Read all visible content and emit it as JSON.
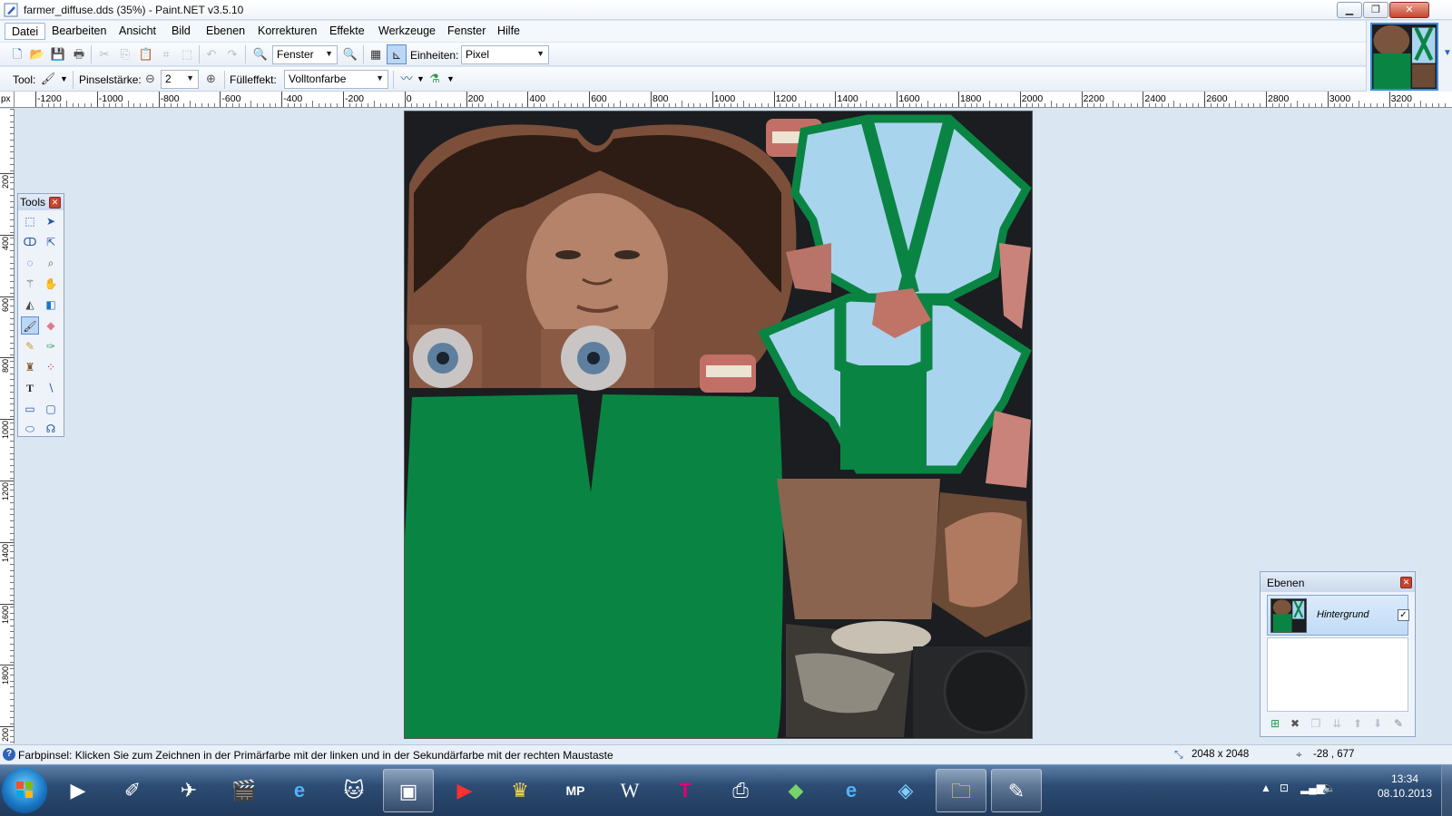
{
  "window": {
    "title": "farmer_diffuse.dds (35%) - Paint.NET v3.5.10"
  },
  "window_buttons": {
    "minimize": "▁",
    "maximize": "❐",
    "close": "✕"
  },
  "menu": [
    "Datei",
    "Bearbeiten",
    "Ansicht",
    "Bild",
    "Ebenen",
    "Korrekturen",
    "Effekte",
    "Werkzeuge",
    "Fenster",
    "Hilfe"
  ],
  "toolbar1": {
    "zoom_value": "Fenster",
    "units_label": "Einheiten:",
    "units_value": "Pixel",
    "icons": [
      "new-file-icon",
      "open-file-icon",
      "save-icon",
      "print-icon",
      "cut-icon",
      "copy-icon",
      "paste-icon",
      "crop-icon",
      "deselect-icon",
      "undo-icon",
      "redo-icon",
      "zoom-out-icon",
      "zoom-in-icon",
      "grid-icon",
      "rulers-icon"
    ]
  },
  "toolbar2": {
    "tool_label": "Tool:",
    "brush_width_label": "Pinselstärke:",
    "brush_width_value": "2",
    "fill_label": "Fülleffekt:",
    "fill_value": "Volltonfarbe"
  },
  "ruler": {
    "unit": "px",
    "h_labels": [
      "-1200",
      "-1000",
      "-800",
      "-600",
      "-400",
      "-200",
      "0",
      "200",
      "400",
      "600",
      "800",
      "1000",
      "1200",
      "1400",
      "1600",
      "1800",
      "2000",
      "2200",
      "2400",
      "2600",
      "2800",
      "3000",
      "3200"
    ],
    "v_labels": [
      "200",
      "400",
      "600",
      "800",
      "1000",
      "1200",
      "1400",
      "1600",
      "1800",
      "200"
    ]
  },
  "tools_window": {
    "title": "Tools",
    "tools": [
      "rectangle-select",
      "move-selection",
      "lasso-select",
      "move-selected",
      "ellipse-select",
      "zoom",
      "magic-wand",
      "pan",
      "paint-bucket",
      "gradient",
      "paintbrush",
      "eraser",
      "pencil",
      "color-picker",
      "clone-stamp",
      "recolor",
      "text",
      "line-curve",
      "rectangle",
      "rounded-rectangle",
      "ellipse",
      "freeform-shape"
    ],
    "selected": "paintbrush"
  },
  "layers_window": {
    "title": "Ebenen",
    "layer_name": "Hintergrund",
    "layer_visible": "✓",
    "buttons": [
      "add-layer",
      "delete-layer",
      "duplicate-layer",
      "merge-down",
      "move-up",
      "move-down",
      "layer-properties"
    ]
  },
  "status": {
    "message": "Farbpinsel: Klicken Sie zum Zeichnen in der Primärfarbe mit der linken und in der Sekundärfarbe mit der rechten Maustaste",
    "image_size": "2048 x 2048",
    "cursor": "-28 , 677"
  },
  "taskbar": {
    "apps": [
      "media-player",
      "paint-tool",
      "airplane-game",
      "movie-app",
      "internet-explorer",
      "cat-app",
      "photo-viewer",
      "youtube",
      "king-game",
      "mp-app",
      "wikipedia",
      "telekom",
      "scanner",
      "spyro-game",
      "internet-explorer-2",
      "cube-app",
      "file-explorer",
      "paint-net"
    ],
    "open": [
      "photo-viewer",
      "file-explorer",
      "paint-net"
    ],
    "time": "13:34",
    "date": "08.10.2013"
  },
  "colors": {
    "green": "#0a8443",
    "skin": "#8a5a44",
    "shirt": "#a9d4ee",
    "canvas_bg": "#1b1d20",
    "workspace": "#dbe6f3"
  }
}
